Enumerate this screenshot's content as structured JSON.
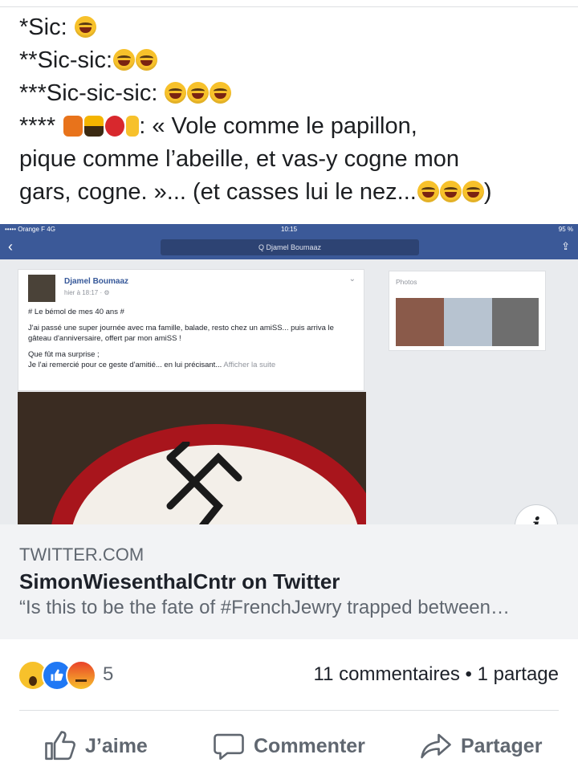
{
  "post": {
    "lines": [
      "*Sic: ",
      "**Sic-sic:",
      "***Sic-sic-sic: ",
      "**** ",
      ": « Vole comme le papillon,",
      "pique comme l’abeille, et vas-y cogne mon",
      "gars, cogne. »... (et casses lui le nez...",
      ")"
    ]
  },
  "screenshot": {
    "carrier": "••••• Orange F  4G",
    "time": "10:15",
    "battery": "95 %",
    "search": "Q Djamel Boumaaz",
    "author": "Djamel Boumaaz",
    "time_posted": "hier à 18:17 · ⚙",
    "body": [
      "# Le bémol de mes 40 ans #",
      "J'ai passé une super journée avec ma famille, balade, resto chez un amiSS... puis arriva le gâteau d'anniversaire, offert par mon amiSS !",
      "Que fût ma surprise ;",
      "Je l'ai remercié pour ce geste d'amitié... en lui précisant..."
    ],
    "see_more": "Afficher la suite",
    "photos_label": "Photos"
  },
  "info_label": "i",
  "link": {
    "domain": "TWITTER.COM",
    "title": "SimonWiesenthalCntr on Twitter",
    "description": "“Is this to be the fate of #FrenchJewry trapped between…"
  },
  "reactions": {
    "icons": [
      "wow-icon",
      "like-icon",
      "angry-icon"
    ],
    "count": "5"
  },
  "meta": {
    "comments": "11 commentaires",
    "separator": " • ",
    "shares": "1 partage"
  },
  "actions": {
    "like": "J’aime",
    "comment": "Commenter",
    "share": "Partager"
  },
  "colors": {
    "fb_blue": "#3b5998",
    "link_bg": "#f2f3f5",
    "text_secondary": "#606770"
  }
}
